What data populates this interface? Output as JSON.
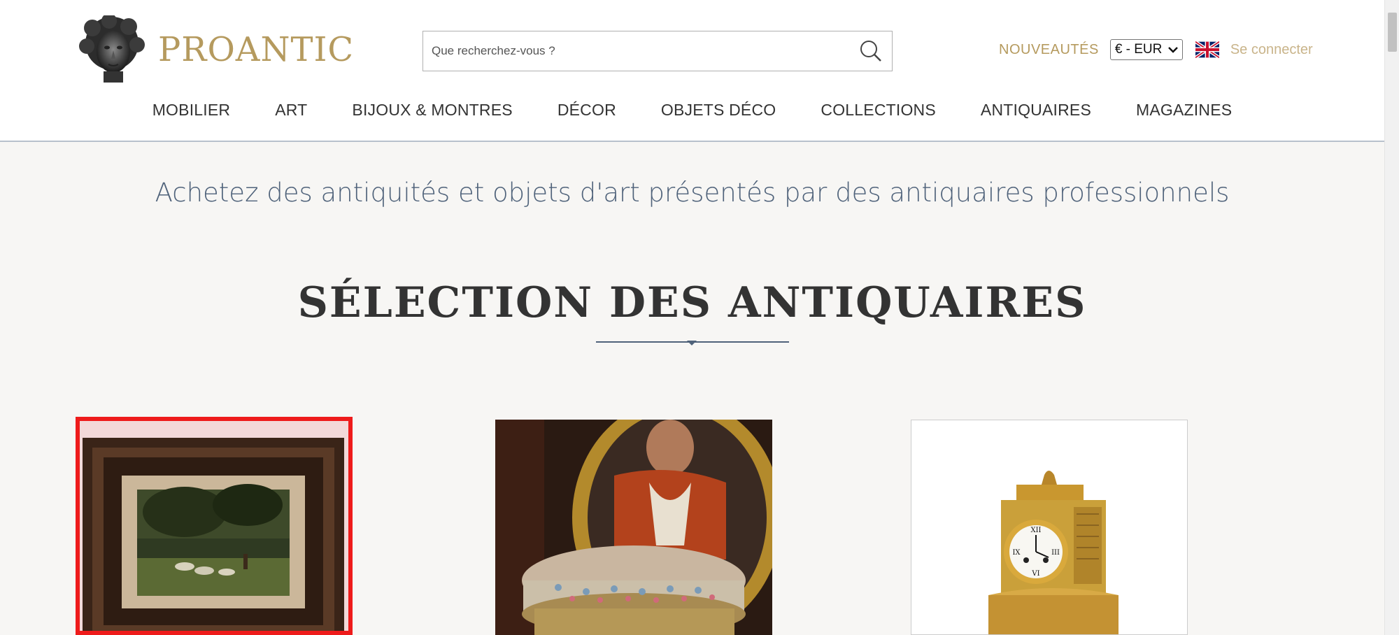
{
  "brand": {
    "name": "PROANTIC"
  },
  "search": {
    "placeholder": "Que recherchez-vous ?"
  },
  "header": {
    "new_label": "NOUVEAUTÉS",
    "currency": "€ - EUR",
    "login_label": "Se connecter",
    "language_icon": "uk-flag-icon"
  },
  "nav": {
    "items": [
      {
        "label": "MOBILIER"
      },
      {
        "label": "ART"
      },
      {
        "label": "BIJOUX & MONTRES"
      },
      {
        "label": "DÉCOR"
      },
      {
        "label": "OBJETS DÉCO"
      },
      {
        "label": "COLLECTIONS"
      },
      {
        "label": "ANTIQUAIRES"
      },
      {
        "label": "MAGAZINES"
      }
    ]
  },
  "main": {
    "tagline": "Achetez des antiquités et objets d'art présentés par des antiquaires professionnels",
    "section_title": "SÉLECTION DES ANTIQUAIRES"
  },
  "colors": {
    "brand_gold": "#b59a5e",
    "slate_blue": "#4f627a",
    "highlight_red": "#ee1b1b"
  },
  "icons": {
    "search": "search-icon",
    "dropdown": "chevron-down-icon"
  }
}
